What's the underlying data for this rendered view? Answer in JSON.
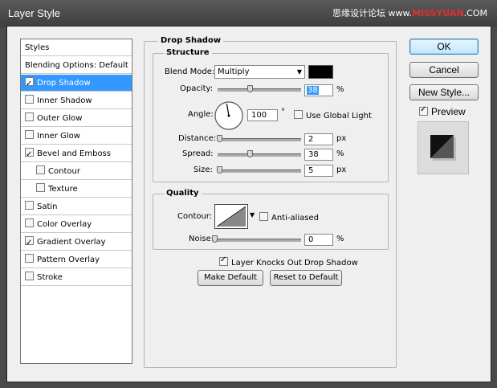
{
  "window": {
    "title": "Layer Style"
  },
  "watermark": {
    "left": "思缘设计论坛",
    "url_prefix": "www.",
    "url_brand": "MISSYUAN",
    "url_suffix": ".COM"
  },
  "styles_panel": {
    "items": [
      {
        "label": "Styles",
        "checkbox": false,
        "checked": false,
        "selected": false,
        "indent": false
      },
      {
        "label": "Blending Options: Default",
        "checkbox": false,
        "checked": false,
        "selected": false,
        "indent": false
      },
      {
        "label": "Drop Shadow",
        "checkbox": true,
        "checked": true,
        "selected": true,
        "indent": false
      },
      {
        "label": "Inner Shadow",
        "checkbox": true,
        "checked": false,
        "selected": false,
        "indent": false
      },
      {
        "label": "Outer Glow",
        "checkbox": true,
        "checked": false,
        "selected": false,
        "indent": false
      },
      {
        "label": "Inner Glow",
        "checkbox": true,
        "checked": false,
        "selected": false,
        "indent": false
      },
      {
        "label": "Bevel and Emboss",
        "checkbox": true,
        "checked": true,
        "selected": false,
        "indent": false
      },
      {
        "label": "Contour",
        "checkbox": true,
        "checked": false,
        "selected": false,
        "indent": true
      },
      {
        "label": "Texture",
        "checkbox": true,
        "checked": false,
        "selected": false,
        "indent": true
      },
      {
        "label": "Satin",
        "checkbox": true,
        "checked": false,
        "selected": false,
        "indent": false
      },
      {
        "label": "Color Overlay",
        "checkbox": true,
        "checked": false,
        "selected": false,
        "indent": false
      },
      {
        "label": "Gradient Overlay",
        "checkbox": true,
        "checked": true,
        "selected": false,
        "indent": false
      },
      {
        "label": "Pattern Overlay",
        "checkbox": true,
        "checked": false,
        "selected": false,
        "indent": false
      },
      {
        "label": "Stroke",
        "checkbox": true,
        "checked": false,
        "selected": false,
        "indent": false
      }
    ]
  },
  "drop_shadow": {
    "title": "Drop Shadow",
    "structure": {
      "title": "Structure",
      "blend_mode_label": "Blend Mode:",
      "blend_mode_value": "Multiply",
      "shadow_color": "#000000",
      "opacity_label": "Opacity:",
      "opacity_value": "38",
      "opacity_level": 0.38,
      "opacity_unit": "%",
      "angle_label": "Angle:",
      "angle_value": "100",
      "angle_unit": "°",
      "use_global_light_label": "Use Global Light",
      "use_global_light": false,
      "distance_label": "Distance:",
      "distance_value": "2",
      "distance_unit": "px",
      "distance_level": 0.02,
      "spread_label": "Spread:",
      "spread_value": "38",
      "spread_unit": "%",
      "spread_level": 0.38,
      "size_label": "Size:",
      "size_value": "5",
      "size_unit": "px",
      "size_level": 0.02
    },
    "quality": {
      "title": "Quality",
      "contour_label": "Contour:",
      "anti_aliased_label": "Anti-aliased",
      "anti_aliased": false,
      "noise_label": "Noise:",
      "noise_value": "0",
      "noise_unit": "%",
      "noise_level": 0
    },
    "knocks_out_label": "Layer Knocks Out Drop Shadow",
    "knocks_out": true,
    "make_default_label": "Make Default",
    "reset_default_label": "Reset to Default"
  },
  "buttons": {
    "ok": "OK",
    "cancel": "Cancel",
    "new_style": "New Style..."
  },
  "preview": {
    "label": "Preview",
    "checked": true
  }
}
